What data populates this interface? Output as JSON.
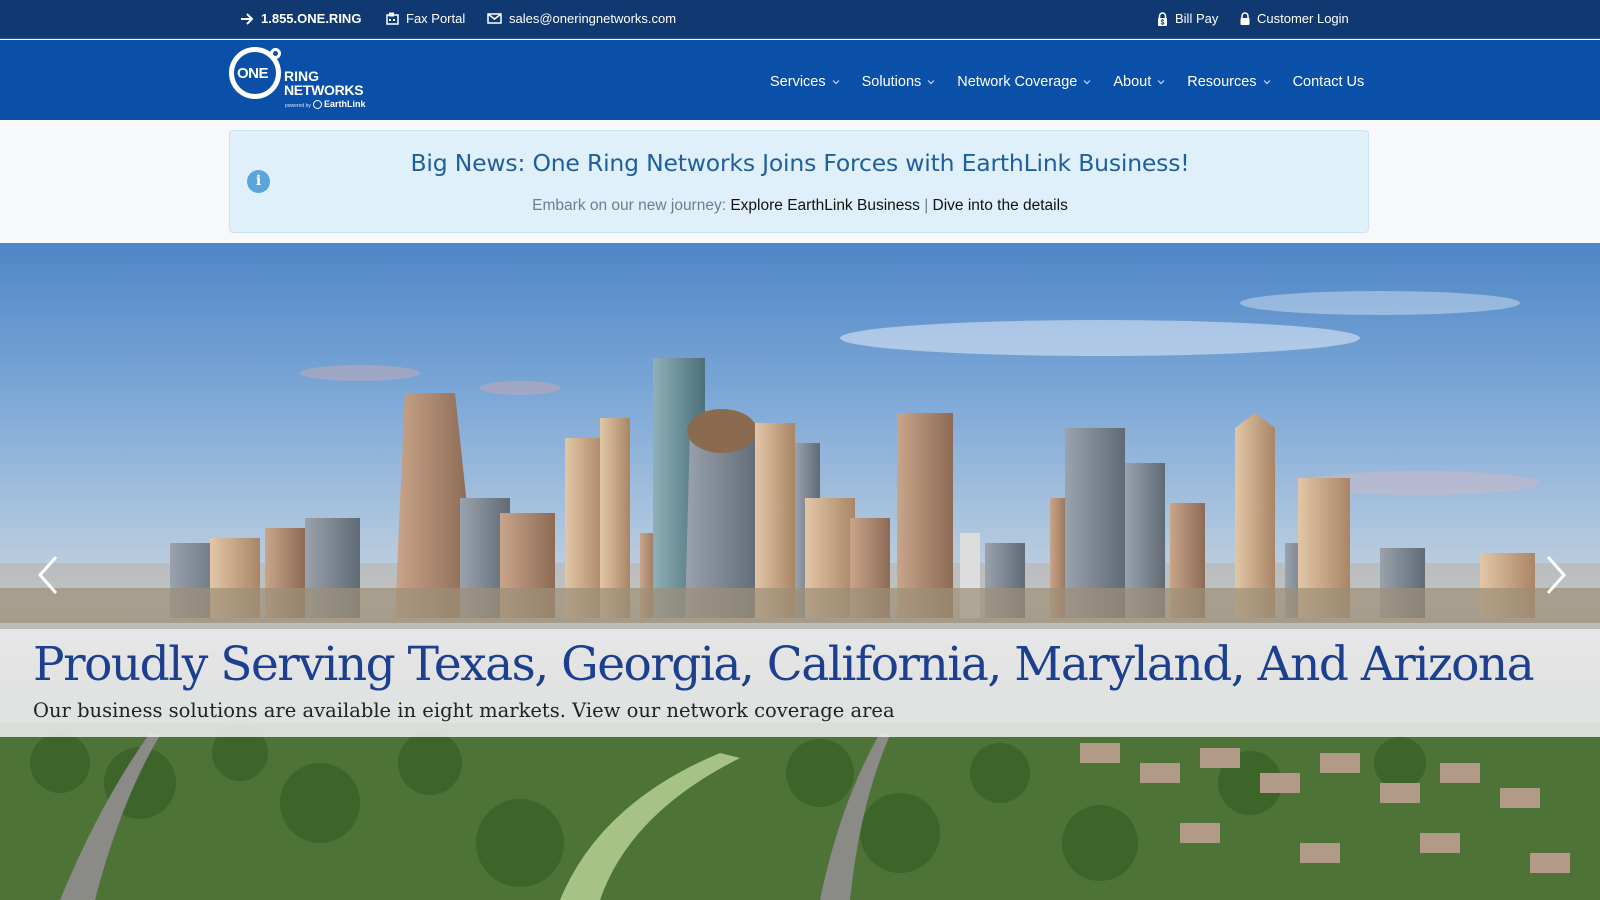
{
  "topbar": {
    "phone": "1.855.ONE.RING",
    "fax_label": "Fax Portal",
    "email": "sales@oneringnetworks.com",
    "bill_pay": "Bill Pay",
    "customer_login": "Customer Login"
  },
  "logo": {
    "one": "ONE",
    "ring": "RING",
    "networks": "NETWORKS",
    "powered_by": "powered by",
    "partner": "EarthLink"
  },
  "nav": {
    "items": [
      {
        "label": "Services",
        "dropdown": true
      },
      {
        "label": "Solutions",
        "dropdown": true
      },
      {
        "label": "Network Coverage",
        "dropdown": true
      },
      {
        "label": "About",
        "dropdown": true
      },
      {
        "label": "Resources",
        "dropdown": true
      },
      {
        "label": "Contact Us",
        "dropdown": false
      }
    ]
  },
  "announcement": {
    "headline": "Big News: One Ring Networks Joins Forces with EarthLink Business!",
    "lead": "Embark on our new journey:",
    "link1": "Explore EarthLink Business",
    "separator": "|",
    "link2": "Dive into the details"
  },
  "hero": {
    "title": "Proudly Serving Texas, Georgia, California, Maryland, And Arizona",
    "description": "Our business solutions are available in eight markets. View our network coverage area"
  },
  "colors": {
    "topbar_bg": "#0f3970",
    "header_bg": "#0a4fa8",
    "announce_bg": "#dff0fb",
    "headline": "#1f5f9e",
    "hero_title": "#1c3f8f"
  }
}
